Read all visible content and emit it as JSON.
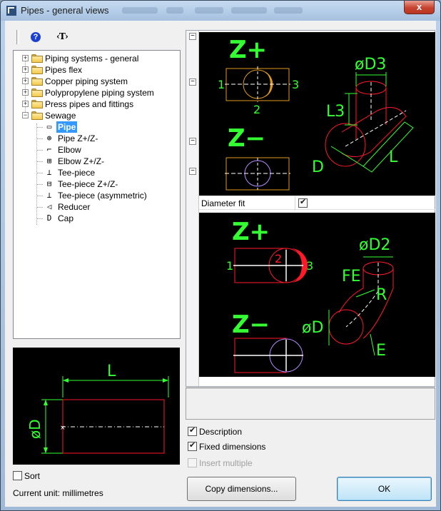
{
  "window": {
    "title": "Pipes - general views",
    "close_glyph": "x"
  },
  "toolbar": {
    "help_glyph": "?",
    "text_glyph": "‹T›"
  },
  "tree": {
    "folders": [
      {
        "label": "Piping systems - general",
        "expander": "+"
      },
      {
        "label": "Pipes flex",
        "expander": "+"
      },
      {
        "label": "Copper piping system",
        "expander": "+"
      },
      {
        "label": "Polypropylene piping system",
        "expander": "+"
      },
      {
        "label": "Press pipes and fittings",
        "expander": "+"
      },
      {
        "label": "Sewage",
        "expander": "−"
      }
    ],
    "children": [
      {
        "label": "Pipe",
        "icon": "▭"
      },
      {
        "label": "Pipe Z+/Z-",
        "icon": "⊕"
      },
      {
        "label": "Elbow",
        "icon": "⌐"
      },
      {
        "label": "Elbow Z+/Z-",
        "icon": "⊞"
      },
      {
        "label": "Tee-piece",
        "icon": "⊥"
      },
      {
        "label": "Tee-piece Z+/Z-",
        "icon": "⊟"
      },
      {
        "label": "Tee-piece (asymmetric)",
        "icon": "⊥"
      },
      {
        "label": "Reducer",
        "icon": "◁"
      },
      {
        "label": "Cap",
        "icon": "D"
      }
    ]
  },
  "preview_small": {
    "dim_length": "L",
    "dim_diameter": "øD"
  },
  "sort_label": "Sort",
  "current_unit": "Current unit: millimetres",
  "options": {
    "description": "Description",
    "fixed_dimensions": "Fixed dimensions",
    "insert_multiple": "Insert multiple"
  },
  "buttons": {
    "copy": "Copy dimensions...",
    "ok": "OK"
  },
  "properties": {
    "diameter_fit": "Diameter fit"
  },
  "img_top": {
    "zplus": "Z+",
    "zminus": "Z−",
    "n1": "1",
    "n2": "2",
    "n3": "3",
    "d3": "øD3",
    "l3": "L3",
    "d": "D",
    "l": "L"
  },
  "img_bot": {
    "zplus": "Z+",
    "zminus": "Z−",
    "n1": "1",
    "n2": "2",
    "n3": "3",
    "d2": "øD2",
    "fe": "FE",
    "r": "R",
    "d": "øD",
    "e": "E"
  },
  "colors": {
    "green": "#33ff33",
    "orange": "#e09a1e",
    "red": "#ff1a2a",
    "violet": "#b48cff",
    "selected": "#3399ff"
  }
}
